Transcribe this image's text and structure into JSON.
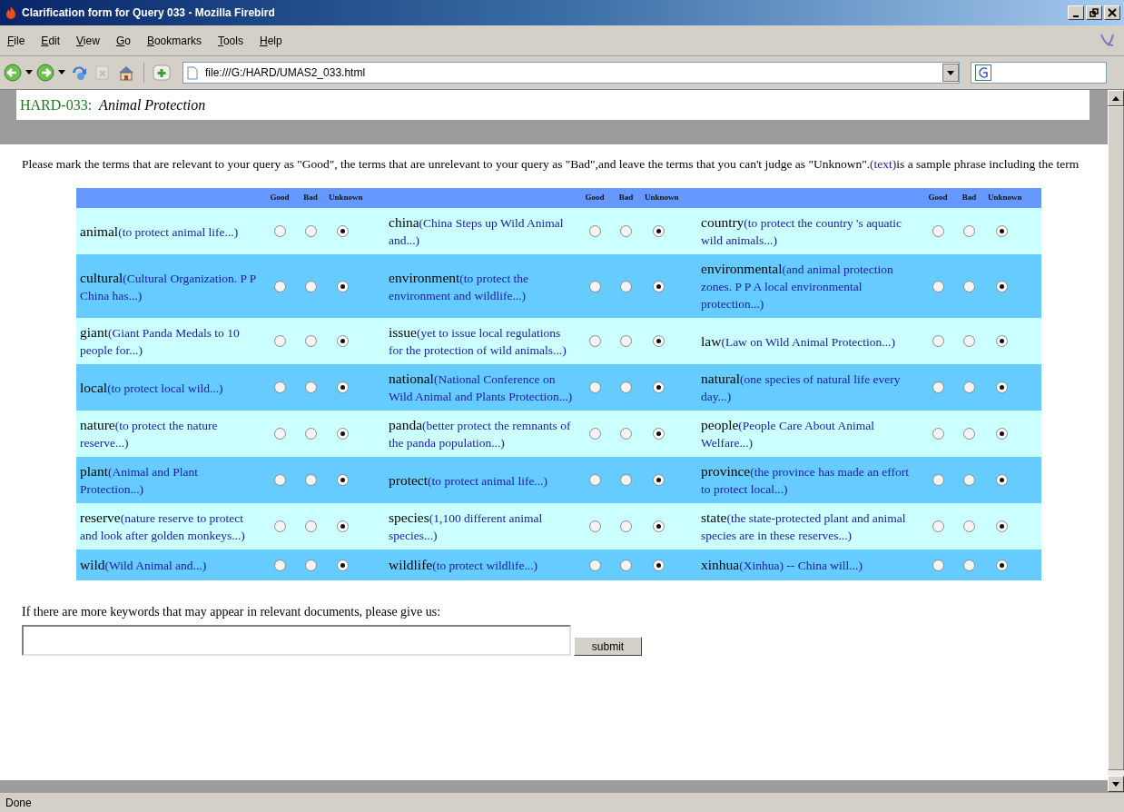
{
  "window": {
    "title": "Clarification form for Query 033 - Mozilla Firebird"
  },
  "menu": [
    "File",
    "Edit",
    "View",
    "Go",
    "Bookmarks",
    "Tools",
    "Help"
  ],
  "address": "file:///G:/HARD/UMAS2_033.html",
  "page_header": {
    "id": "HARD-033:",
    "topic": "Animal Protection"
  },
  "instructions": {
    "text": "Please mark the terms that are relevant to your query as \"Good\", the terms that are unrelevant to your query as \"Bad\",and leave the terms that you can't judge as \"Unknown\".",
    "sample": "(text)",
    "after": "is a sample phrase including the term"
  },
  "table": {
    "header_groups": [
      [
        "Good",
        "Bad",
        "Unknown"
      ],
      [
        "Good",
        "Bad",
        "Unknown"
      ],
      [
        "Good",
        "Bad",
        "Unknown"
      ]
    ],
    "rows": [
      [
        {
          "term": "animal",
          "phrase": "(to protect animal life...)",
          "radios": [
            {
              "selected": false
            },
            {
              "selected": false
            },
            {
              "selected": true
            }
          ]
        },
        {
          "term": "china",
          "phrase": "(China Steps up Wild Animal and...)",
          "radios": [
            {
              "selected": false
            },
            {
              "selected": false
            },
            {
              "selected": true
            }
          ]
        },
        {
          "term": "country",
          "phrase": "(to protect the country 's aquatic wild animals...)",
          "radios": [
            {
              "selected": false
            },
            {
              "selected": false
            },
            {
              "selected": true
            }
          ]
        }
      ],
      [
        {
          "term": "cultural",
          "phrase": "(Cultural Organization. P P China has...)",
          "radios": [
            {
              "selected": false
            },
            {
              "selected": false
            },
            {
              "selected": true
            }
          ]
        },
        {
          "term": "environment",
          "phrase": "(to protect the environment and wildlife...)",
          "radios": [
            {
              "selected": false
            },
            {
              "selected": false
            },
            {
              "selected": true
            }
          ]
        },
        {
          "term": "environmental",
          "phrase": "(and animal protection zones. P P A local environmental protection...)",
          "radios": [
            {
              "selected": false
            },
            {
              "selected": false
            },
            {
              "selected": true
            }
          ]
        }
      ],
      [
        {
          "term": "giant",
          "phrase": "(Giant Panda Medals to 10 people for...)",
          "radios": [
            {
              "selected": false
            },
            {
              "selected": false
            },
            {
              "selected": true
            }
          ]
        },
        {
          "term": "issue",
          "phrase": "(yet to issue local regulations for the protection of wild animals...)",
          "radios": [
            {
              "selected": false
            },
            {
              "selected": false
            },
            {
              "selected": true
            }
          ]
        },
        {
          "term": "law",
          "phrase": "(Law on Wild Animal Protection...)",
          "radios": [
            {
              "selected": false
            },
            {
              "selected": false
            },
            {
              "selected": true
            }
          ]
        }
      ],
      [
        {
          "term": "local",
          "phrase": "(to protect local wild...)",
          "radios": [
            {
              "selected": false
            },
            {
              "selected": false
            },
            {
              "selected": true
            }
          ]
        },
        {
          "term": "national",
          "phrase": "(National Conference on Wild Animal and Plants Protection...)",
          "radios": [
            {
              "selected": false
            },
            {
              "selected": false
            },
            {
              "selected": true
            }
          ]
        },
        {
          "term": "natural",
          "phrase": "(one species of natural life every day...)",
          "radios": [
            {
              "selected": false
            },
            {
              "selected": false
            },
            {
              "selected": true
            }
          ]
        }
      ],
      [
        {
          "term": "nature",
          "phrase": "(to protect the nature reserve...)",
          "radios": [
            {
              "selected": false
            },
            {
              "selected": false
            },
            {
              "selected": true
            }
          ]
        },
        {
          "term": "panda",
          "phrase": "(better protect the remnants of the panda population...)",
          "radios": [
            {
              "selected": false
            },
            {
              "selected": false
            },
            {
              "selected": true
            }
          ]
        },
        {
          "term": "people",
          "phrase": "(People Care About Animal Welfare...)",
          "radios": [
            {
              "selected": false
            },
            {
              "selected": false
            },
            {
              "selected": true
            }
          ]
        }
      ],
      [
        {
          "term": "plant",
          "phrase": "(Animal and Plant Protection...)",
          "radios": [
            {
              "selected": false
            },
            {
              "selected": false
            },
            {
              "selected": true
            }
          ]
        },
        {
          "term": "protect",
          "phrase": "(to protect animal life...)",
          "radios": [
            {
              "selected": false
            },
            {
              "selected": false
            },
            {
              "selected": true
            }
          ]
        },
        {
          "term": "province",
          "phrase": "(the province has made an effort to protect local...)",
          "radios": [
            {
              "selected": false
            },
            {
              "selected": false
            },
            {
              "selected": true
            }
          ]
        }
      ],
      [
        {
          "term": "reserve",
          "phrase": "(nature reserve to protect and look after golden monkeys...)",
          "radios": [
            {
              "selected": false
            },
            {
              "selected": false
            },
            {
              "selected": true
            }
          ]
        },
        {
          "term": "species",
          "phrase": "(1,100 different animal species...)",
          "radios": [
            {
              "selected": false
            },
            {
              "selected": false
            },
            {
              "selected": true
            }
          ]
        },
        {
          "term": "state",
          "phrase": "(the state-protected plant and animal species are in these reserves...)",
          "radios": [
            {
              "selected": false
            },
            {
              "selected": false
            },
            {
              "selected": true
            }
          ]
        }
      ],
      [
        {
          "term": "wild",
          "phrase": "(Wild Animal and...)",
          "radios": [
            {
              "selected": false
            },
            {
              "selected": false
            },
            {
              "selected": true
            }
          ]
        },
        {
          "term": "wildlife",
          "phrase": "(to protect wildlife...)",
          "radios": [
            {
              "selected": false
            },
            {
              "selected": false
            },
            {
              "selected": true
            }
          ]
        },
        {
          "term": "xinhua",
          "phrase": "(Xinhua) -- China will...)",
          "radios": [
            {
              "selected": false
            },
            {
              "selected": false
            },
            {
              "selected": true
            }
          ]
        }
      ]
    ]
  },
  "more_keywords": {
    "label": "If there are more keywords that may appear in relevant documents, please give us:",
    "submit": "submit"
  },
  "status_bar": "Done"
}
